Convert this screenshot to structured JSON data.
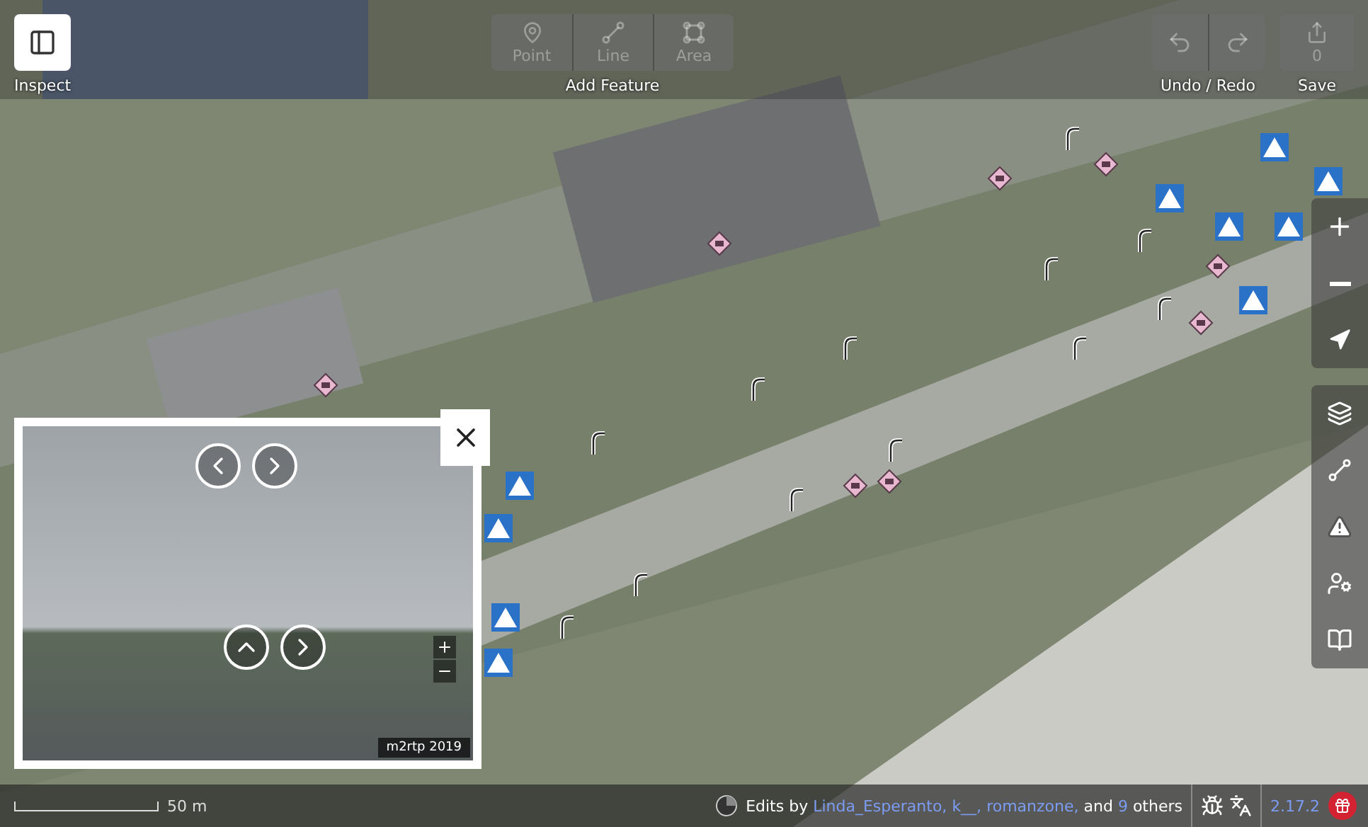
{
  "top_bar": {
    "inspect": {
      "label": "Inspect",
      "selected": true
    },
    "add_feature": {
      "label": "Add Feature",
      "modes": [
        {
          "kind": "point",
          "label": "Point",
          "disabled": true
        },
        {
          "kind": "line",
          "label": "Line",
          "disabled": true
        },
        {
          "kind": "area",
          "label": "Area",
          "disabled": true
        }
      ]
    },
    "history": {
      "label": "Undo / Redo",
      "buttons": [
        {
          "kind": "undo",
          "disabled": true
        },
        {
          "kind": "redo",
          "disabled": true
        }
      ]
    },
    "save": {
      "label": "Save",
      "count": "0",
      "disabled": true
    }
  },
  "photo_viewer": {
    "attribution": "m2rtp 2019"
  },
  "footer": {
    "scale": "50 m",
    "attribution": [
      {
        "kind": "plain",
        "text": "Edits by"
      },
      {
        "kind": "link",
        "text": "Linda_Esperanto,"
      },
      {
        "kind": "link",
        "text": "k__,"
      },
      {
        "kind": "link",
        "text": "romanzone,"
      },
      {
        "kind": "plain",
        "text": "and"
      },
      {
        "kind": "link",
        "text": "9"
      },
      {
        "kind": "plain",
        "text": "others"
      }
    ],
    "version": "2.17.2"
  }
}
